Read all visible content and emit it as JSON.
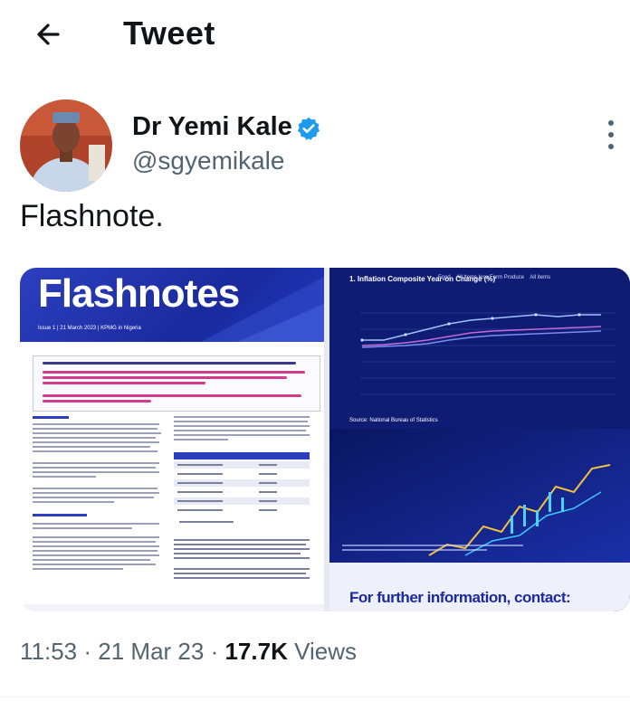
{
  "header": {
    "title": "Tweet",
    "back_icon": "arrow-left-icon"
  },
  "author": {
    "name": "Dr Yemi Kale",
    "handle": "@sgyemikale",
    "verified": true,
    "verified_color": "#1d9bf0"
  },
  "tweet": {
    "text": "Flashnote."
  },
  "media": {
    "left_doc": {
      "title": "Flashnotes",
      "issue_line": "Issue 1 | 21 March 2023 | KPMG in Nigeria"
    },
    "right_doc": {
      "chart_title": "1. Inflation Composite Year-on Change (%)",
      "legend": [
        "Food",
        "All Items less Farm Produce",
        "All items"
      ],
      "source": "Source: National Bureau of Statistics",
      "footer": "For further information, contact:"
    }
  },
  "meta": {
    "time": "11:53",
    "date": "21 Mar 23",
    "views_count": "17.7K",
    "views_label": "Views"
  },
  "colors": {
    "accent": "#1d9bf0",
    "doc_blue": "#1a2a9e"
  }
}
